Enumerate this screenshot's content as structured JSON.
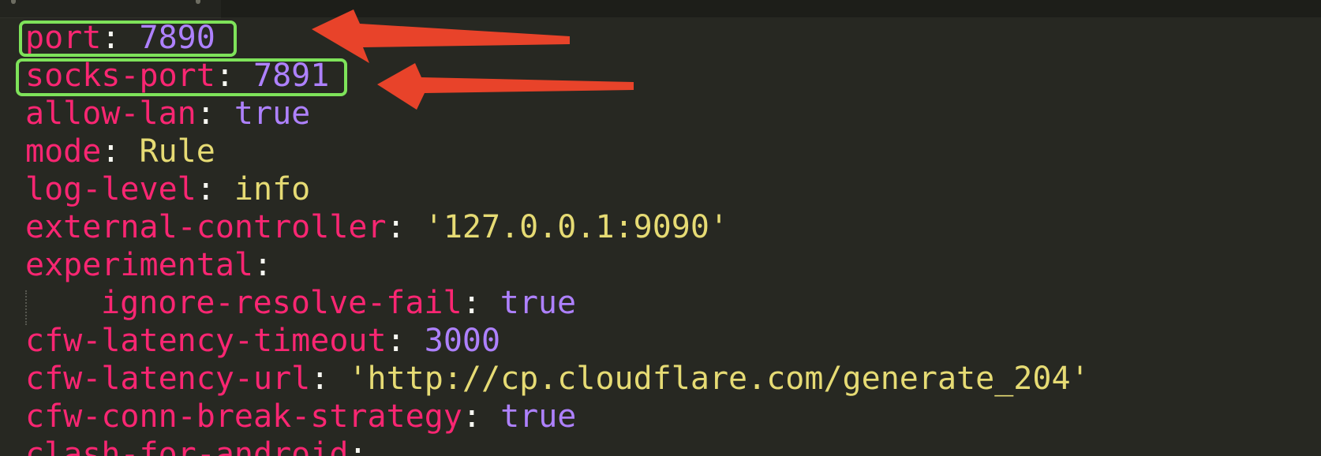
{
  "colors": {
    "background": "#272822",
    "key": "#f92672",
    "punctuation": "#f8f8f2",
    "number": "#ae81ff",
    "string": "#e6db74",
    "highlight_box": "#7ee35a",
    "arrow": "#e8432a"
  },
  "code": {
    "lines": [
      {
        "key": "port",
        "sep": ": ",
        "value": "7890",
        "type": "number"
      },
      {
        "key": "socks-port",
        "sep": ": ",
        "value": "7891",
        "type": "number"
      },
      {
        "key": "allow-lan",
        "sep": ": ",
        "value": "true",
        "type": "bool"
      },
      {
        "key": "mode",
        "sep": ": ",
        "value": "Rule",
        "type": "string"
      },
      {
        "key": "log-level",
        "sep": ": ",
        "value": "info",
        "type": "string"
      },
      {
        "key": "external-controller",
        "sep": ": ",
        "value": "'127.0.0.1:9090'",
        "type": "string"
      },
      {
        "key": "experimental",
        "sep": ":",
        "value": "",
        "type": "none"
      },
      {
        "key": "ignore-resolve-fail",
        "sep": ": ",
        "value": "true",
        "type": "bool"
      },
      {
        "key": "cfw-latency-timeout",
        "sep": ": ",
        "value": "3000",
        "type": "number"
      },
      {
        "key": "cfw-latency-url",
        "sep": ": ",
        "value": "'http://cp.cloudflare.com/generate_204'",
        "type": "string"
      },
      {
        "key": "cfw-conn-break-strategy",
        "sep": ": ",
        "value": "true",
        "type": "bool"
      },
      {
        "key": "clash-for-android",
        "sep": ":",
        "value": "",
        "type": "none"
      }
    ]
  },
  "annotations": {
    "boxes": [
      {
        "target_line": 1,
        "icon": "highlight-box"
      },
      {
        "target_line": 2,
        "icon": "highlight-box"
      }
    ],
    "arrows": [
      {
        "target_line": 1,
        "icon": "arrow-left"
      },
      {
        "target_line": 2,
        "icon": "arrow-left"
      }
    ]
  }
}
